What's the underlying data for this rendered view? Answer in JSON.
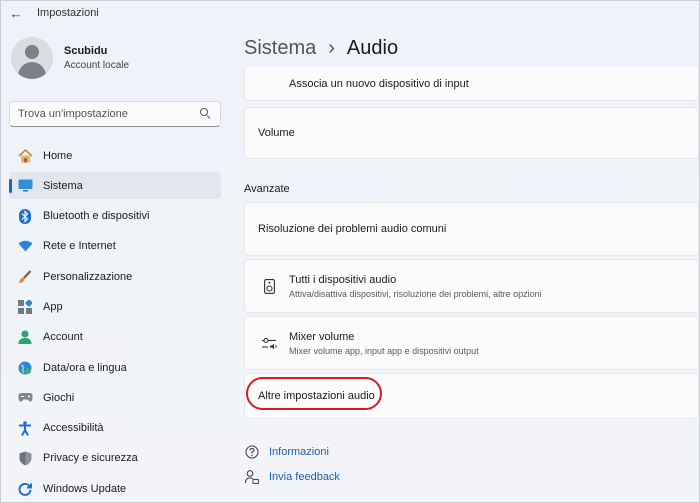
{
  "window": {
    "title": "Impostazioni"
  },
  "profile": {
    "name": "Scubidu",
    "account_type": "Account locale"
  },
  "search": {
    "placeholder": "Trova un'impostazione"
  },
  "sidebar": {
    "items": [
      {
        "label": "Home",
        "icon": "home-icon"
      },
      {
        "label": "Sistema",
        "icon": "system-icon",
        "active": true
      },
      {
        "label": "Bluetooth e dispositivi",
        "icon": "bluetooth-icon"
      },
      {
        "label": "Rete e Internet",
        "icon": "wifi-icon"
      },
      {
        "label": "Personalizzazione",
        "icon": "brush-icon"
      },
      {
        "label": "App",
        "icon": "apps-icon"
      },
      {
        "label": "Account",
        "icon": "account-icon"
      },
      {
        "label": "Data/ora e lingua",
        "icon": "globe-icon"
      },
      {
        "label": "Giochi",
        "icon": "gamepad-icon"
      },
      {
        "label": "Accessibilità",
        "icon": "accessibility-icon"
      },
      {
        "label": "Privacy e sicurezza",
        "icon": "shield-icon"
      },
      {
        "label": "Windows Update",
        "icon": "update-icon"
      }
    ]
  },
  "breadcrumb": {
    "parent": "Sistema",
    "separator": "›",
    "current": "Audio"
  },
  "main": {
    "pair_input": "Associa un nuovo dispositivo di input",
    "volume": "Volume",
    "advanced_section": "Avanzate",
    "troubleshoot": "Risoluzione dei problemi audio comuni",
    "all_devices": {
      "title": "Tutti i dispositivi audio",
      "subtitle": "Attiva/disattiva dispositivi, risoluzione dei problemi, altre opzioni"
    },
    "mixer": {
      "title": "Mixer volume",
      "subtitle": "Mixer volume app, input app e dispositivi output"
    },
    "more_settings": "Altre impostazioni audio"
  },
  "links": {
    "info": "Informazioni",
    "feedback": "Invia feedback"
  },
  "colors": {
    "accent": "#1a63c6",
    "highlight_ring": "#d21e1e",
    "link": "#1a5fb4"
  }
}
